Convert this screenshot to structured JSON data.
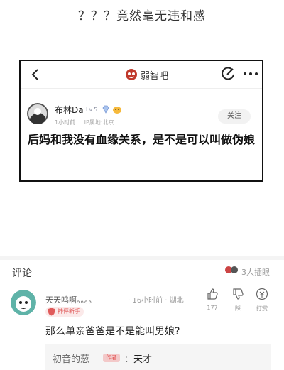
{
  "caption": "？？？竟然毫无违和感",
  "post_screenshot": {
    "forum_name": "弱智吧",
    "poster": {
      "name": "布林Da",
      "level": "Lv.5",
      "time": "1小时前",
      "ip_location": "IP属地:北京"
    },
    "follow_label": "关注",
    "text": "后妈和我没有血缘关系，是不是可以叫做伪娘"
  },
  "comments_section": {
    "title": "评论",
    "interject_count": "3人插眼",
    "comment": {
      "user_name": "天天鸣啊。。。。",
      "time_location": "· 16小时前 · 湖北",
      "badge": "神评新手",
      "text": "那么单亲爸爸是不是能叫男娘?",
      "like_count": "177",
      "dislike_label": "踩",
      "tip_label": "打赏",
      "reply": {
        "author": "初音的葱",
        "author_tag": "作者",
        "separator": "：",
        "text": "天才"
      }
    }
  },
  "colors": {
    "badge_red": "#e05a5a",
    "card_border": "#111111"
  }
}
